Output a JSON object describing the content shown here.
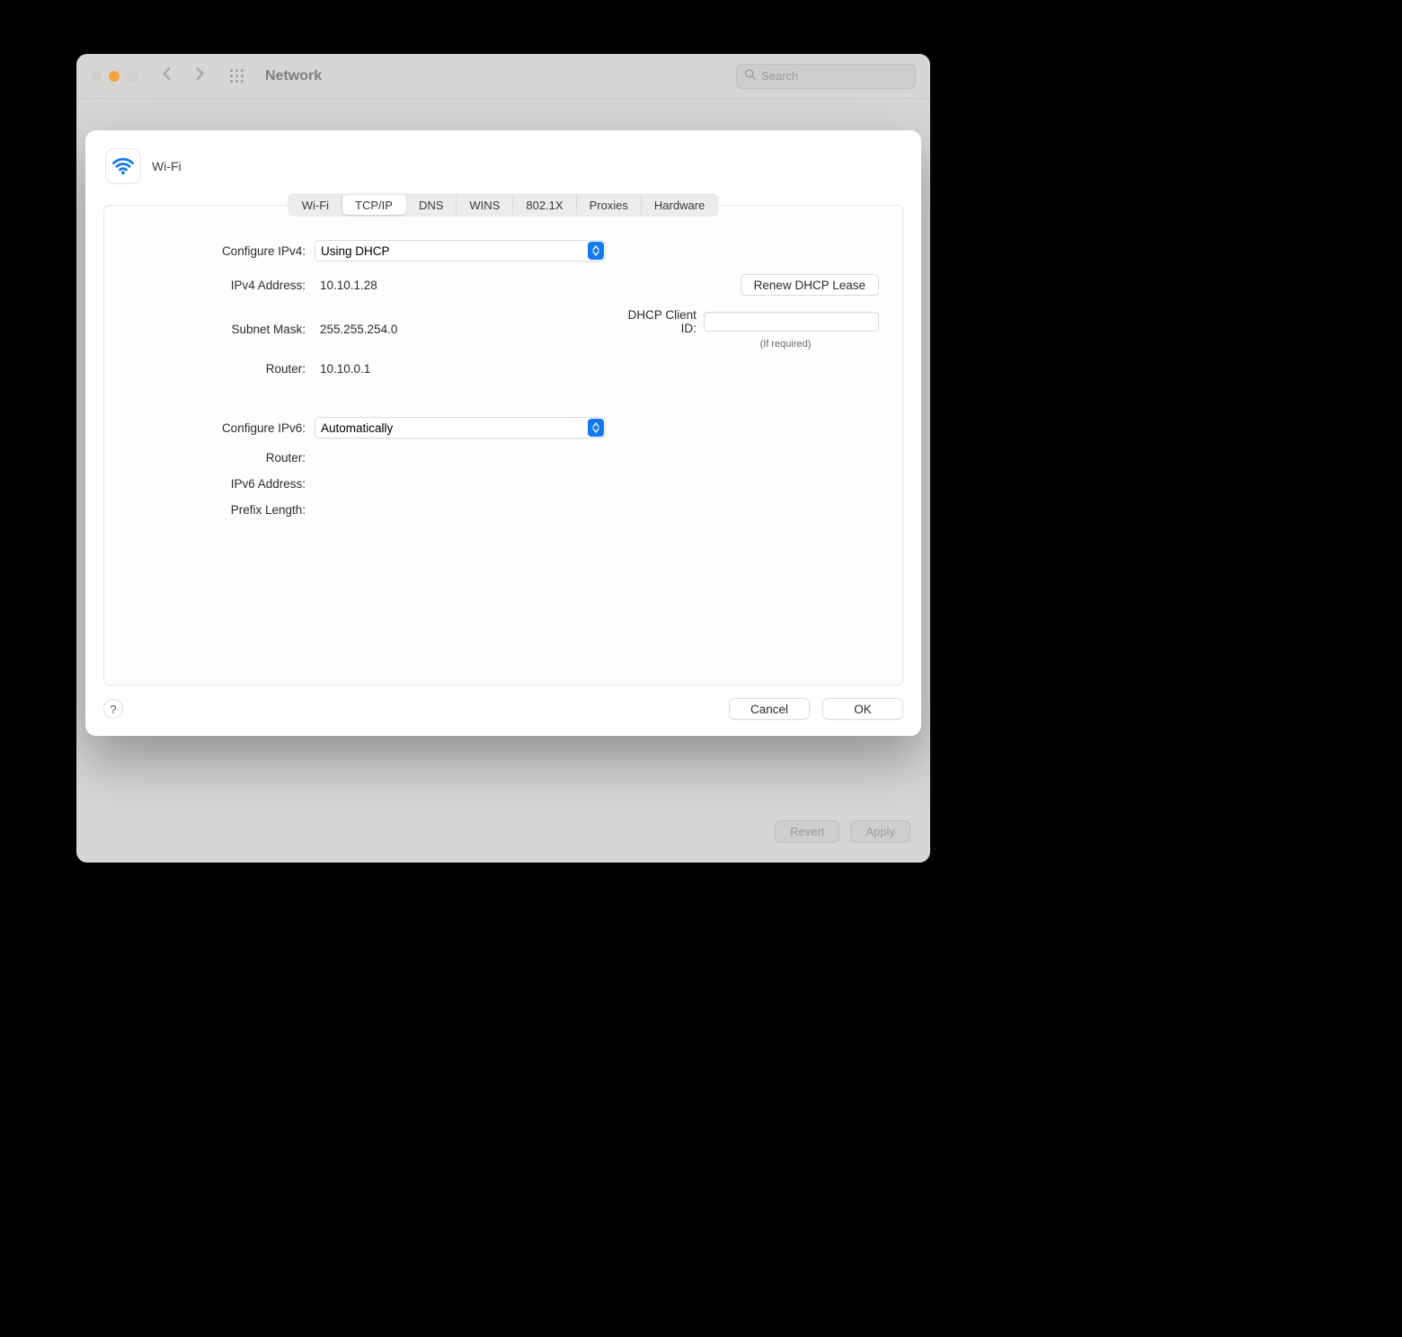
{
  "window": {
    "title": "Network",
    "search_placeholder": "Search"
  },
  "bg_buttons": {
    "revert": "Revert",
    "apply": "Apply"
  },
  "sheet": {
    "title": "Wi-Fi",
    "tabs": [
      "Wi-Fi",
      "TCP/IP",
      "DNS",
      "WINS",
      "802.1X",
      "Proxies",
      "Hardware"
    ],
    "active_tab_index": 1,
    "help_label": "?",
    "cancel": "Cancel",
    "ok": "OK"
  },
  "tcpip": {
    "configure_ipv4_label": "Configure IPv4:",
    "configure_ipv4_value": "Using DHCP",
    "ipv4_address_label": "IPv4 Address:",
    "ipv4_address_value": "10.10.1.28",
    "subnet_mask_label": "Subnet Mask:",
    "subnet_mask_value": "255.255.254.0",
    "router4_label": "Router:",
    "router4_value": "10.10.0.1",
    "renew_lease": "Renew DHCP Lease",
    "dhcp_client_id_label": "DHCP Client ID:",
    "dhcp_client_id_value": "",
    "dhcp_client_hint": "(If required)",
    "configure_ipv6_label": "Configure IPv6:",
    "configure_ipv6_value": "Automatically",
    "router6_label": "Router:",
    "router6_value": "",
    "ipv6_address_label": "IPv6 Address:",
    "ipv6_address_value": "",
    "prefix_length_label": "Prefix Length:",
    "prefix_length_value": ""
  }
}
